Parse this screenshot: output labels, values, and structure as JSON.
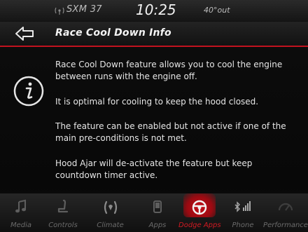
{
  "status": {
    "station": "SXM 37",
    "time": "10:25",
    "temperature": "40°out"
  },
  "header": {
    "back_icon": "back-arrow-icon",
    "title": "Race Cool Down Info"
  },
  "content": {
    "icon": "info-icon",
    "paragraphs": [
      "Race Cool Down feature allows you to cool the engine between runs with the engine off.",
      "It is optimal for cooling to keep the hood closed.",
      "The feature can be enabled but not active if one of the main pre-conditions is not met.",
      "Hood Ajar will de-activate the feature but keep countdown timer active."
    ]
  },
  "nav": {
    "items": [
      {
        "label": "Media",
        "icon": "music-note-icon"
      },
      {
        "label": "Controls",
        "icon": "seat-icon"
      },
      {
        "label": "Climate",
        "icon": "climate-icon"
      },
      {
        "label": "Apps",
        "icon": "apps-icon"
      },
      {
        "label": "Dodge Apps",
        "icon": "steering-wheel-icon",
        "active": true
      },
      {
        "label": "Phone",
        "icon": "phone-bluetooth-icon"
      },
      {
        "label": "Performance",
        "icon": "gauge-icon"
      }
    ]
  },
  "colors": {
    "accent": "#c1121f",
    "background": "#0a0a0a",
    "text": "#e6e6e6",
    "inactive_label": "#6b6b6b"
  }
}
